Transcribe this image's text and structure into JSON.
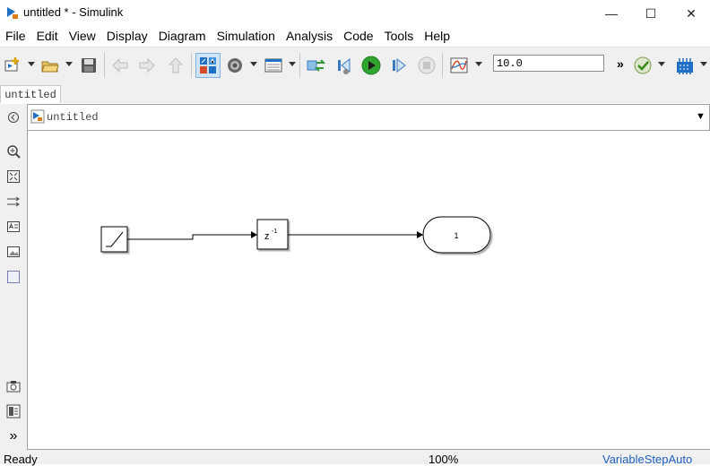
{
  "window": {
    "title": "untitled * - Simulink",
    "minimize_glyph": "—",
    "maximize_glyph": "☐",
    "close_glyph": "✕"
  },
  "menubar": {
    "items": [
      "File",
      "Edit",
      "View",
      "Display",
      "Diagram",
      "Simulation",
      "Analysis",
      "Code",
      "Tools",
      "Help"
    ]
  },
  "toolbar": {
    "stop_time_value": "10.0",
    "overflow_glyph": "»",
    "icons": [
      "new-model-icon",
      "open-icon",
      "save-icon",
      "back-icon",
      "forward-icon",
      "up-icon",
      "library-browser-icon",
      "model-configuration-icon",
      "model-explorer-icon",
      "step-back-icon",
      "step-back-icon",
      "run-icon",
      "step-forward-icon",
      "stop-icon",
      "data-inspector-icon",
      "model-advisor-icon",
      "build-icon"
    ]
  },
  "tabs": [
    {
      "label": "untitled"
    }
  ],
  "address_bar": {
    "path": "untitled",
    "dropdown_glyph": "▼"
  },
  "palette": {
    "icons": [
      "hide-browser-icon",
      "zoom-icon",
      "fit-view-icon",
      "route-lines-icon",
      "annotation-icon",
      "image-icon",
      "area-icon",
      "screenshot-icon",
      "model-properties-icon",
      "expand-icon"
    ],
    "expand_glyph": "»"
  },
  "diagram": {
    "blocks": [
      {
        "name": "ramp",
        "label": ""
      },
      {
        "name": "unit-delay",
        "label": "z-1",
        "base": "z",
        "exponent": "-1"
      },
      {
        "name": "outport",
        "label": "1"
      }
    ]
  },
  "statusbar": {
    "status": "Ready",
    "zoom": "100%",
    "solver": "VariableStepAuto"
  },
  "colors": {
    "toolbar_bg": "#f0f0f0",
    "accent_blue": "#1f6fc5",
    "run_green": "#2fa52f",
    "solver_link": "#1f5fbf"
  }
}
